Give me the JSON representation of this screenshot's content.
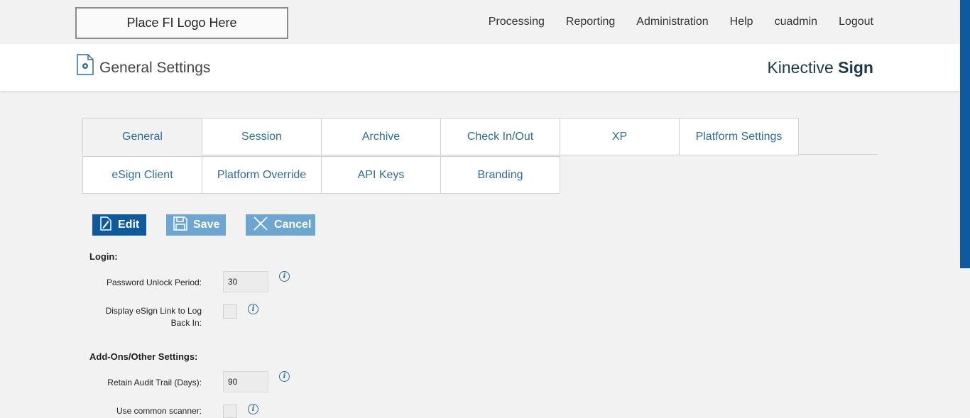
{
  "header": {
    "logo_text": "Place FI Logo Here",
    "nav": [
      "Processing",
      "Reporting",
      "Administration",
      "Help",
      "cuadmin",
      "Logout"
    ]
  },
  "titlebar": {
    "page_title": "General Settings",
    "brand_light": "Kinective",
    "brand_bold": "Sign"
  },
  "tabs": {
    "row1": [
      "General",
      "Session",
      "Archive",
      "Check In/Out",
      "XP",
      "Platform Settings"
    ],
    "row2": [
      "eSign Client",
      "Platform Override",
      "API Keys",
      "Branding"
    ],
    "active": "General"
  },
  "toolbar": {
    "edit_label": "Edit",
    "save_label": "Save",
    "cancel_label": "Cancel"
  },
  "sections": {
    "login": {
      "title": "Login:",
      "password_unlock_label": "Password Unlock Period:",
      "password_unlock_value": "30",
      "esign_link_label_line1": "Display eSign Link to Log",
      "esign_link_label_line2": "Back In:"
    },
    "addons": {
      "title": "Add-Ons/Other Settings:",
      "retain_audit_label": "Retain Audit Trail (Days):",
      "retain_audit_value": "90",
      "common_scanner_label": "Use common scanner:"
    }
  },
  "colors": {
    "primary": "#0e5a9c",
    "button_disabled": "#6ea6d2",
    "link": "#2a6f9e",
    "brand": "#1b3a4b"
  },
  "icons": {
    "info": "i"
  }
}
